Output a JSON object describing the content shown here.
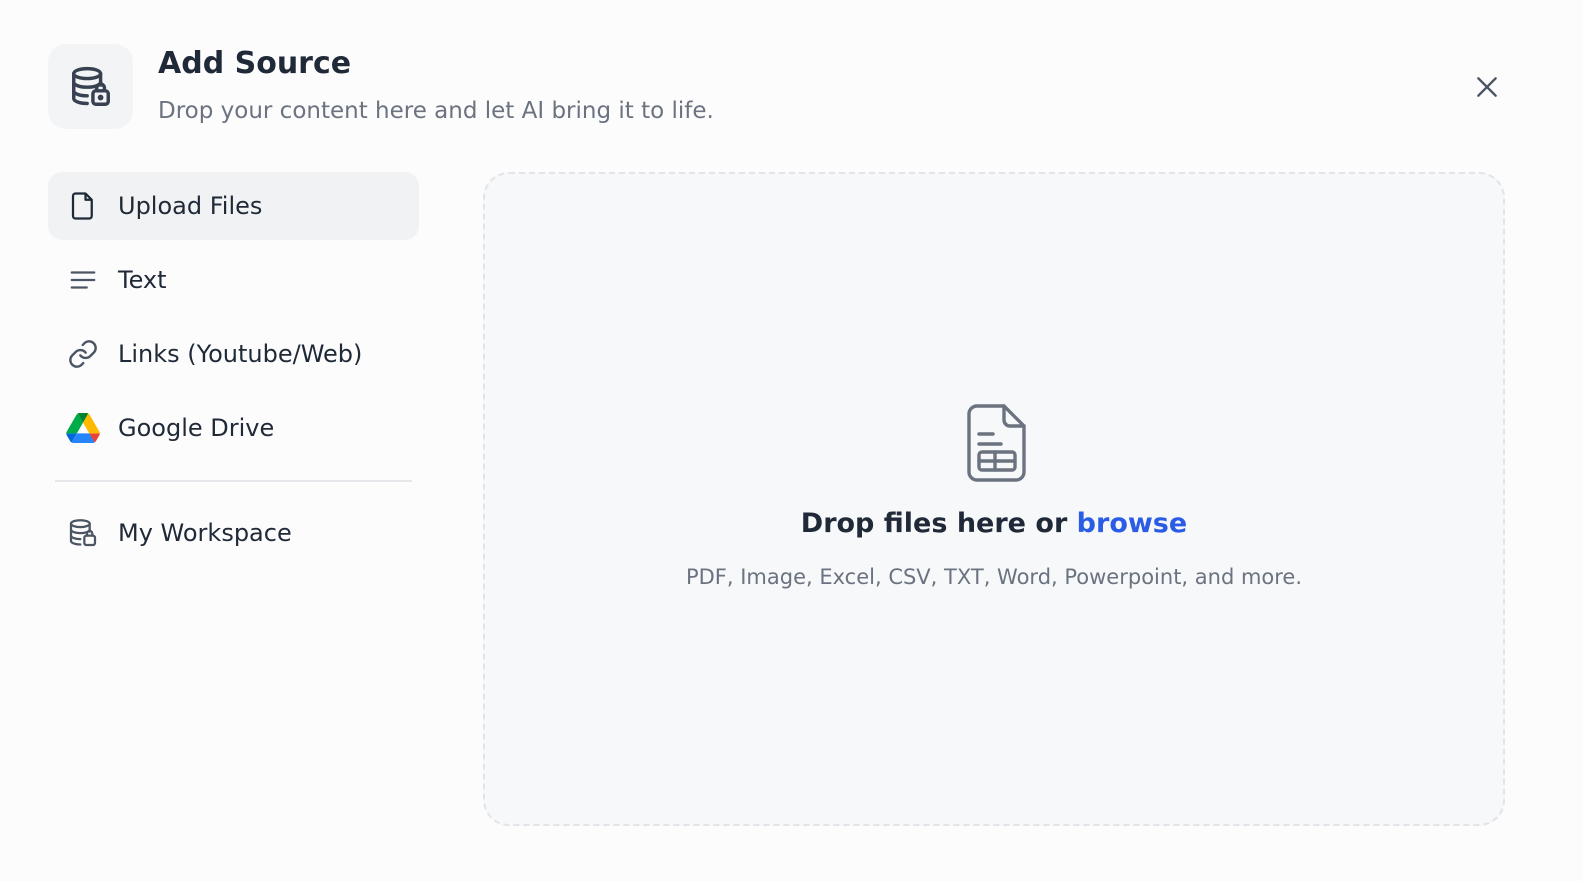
{
  "header": {
    "title": "Add Source",
    "subtitle": "Drop your content here and let AI bring it to life.",
    "icon": "database-lock-icon",
    "close_icon": "close-icon"
  },
  "sidebar": {
    "items": [
      {
        "label": "Upload Files",
        "icon": "file-icon",
        "active": true
      },
      {
        "label": "Text",
        "icon": "text-lines-icon",
        "active": false
      },
      {
        "label": "Links (Youtube/Web)",
        "icon": "link-icon",
        "active": false
      },
      {
        "label": "Google Drive",
        "icon": "google-drive-icon",
        "active": false
      }
    ],
    "workspace": {
      "label": "My Workspace",
      "icon": "database-lock-icon"
    }
  },
  "dropzone": {
    "icon": "spreadsheet-file-icon",
    "prompt": "Drop files here or ",
    "browse_label": "browse",
    "hint": "PDF, Image, Excel, CSV, TXT, Word, Powerpoint, and more."
  },
  "colors": {
    "accent": "#2b5ce6",
    "text_primary": "#1f2937",
    "text_secondary": "#6b7280",
    "active_bg": "#f1f2f4"
  }
}
